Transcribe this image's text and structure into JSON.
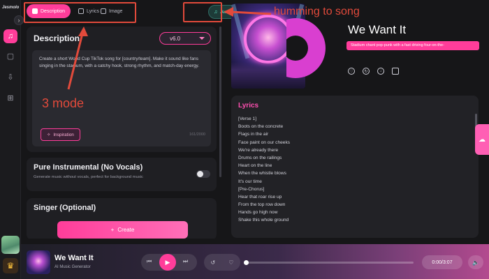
{
  "app": {
    "logo": "Jesmolo"
  },
  "rail": {
    "collapse_icon": "chevron-right-icon",
    "items": [
      {
        "icon": "music-note-icon",
        "active": true
      },
      {
        "icon": "document-icon",
        "active": false
      },
      {
        "icon": "download-icon",
        "active": false
      },
      {
        "icon": "grid-icon",
        "active": false
      }
    ],
    "crown_icon": "crown-icon"
  },
  "tabs": [
    {
      "label": "Description",
      "icon": "description-icon",
      "active": true
    },
    {
      "label": "Lyrics",
      "icon": "lyrics-icon",
      "active": false
    },
    {
      "label": "Image",
      "icon": "image-icon",
      "active": false
    }
  ],
  "audio_button": {
    "label": "Audio",
    "icon": "audio-icon"
  },
  "description": {
    "title": "Description",
    "version": "v6.0",
    "text": "Create a short World Cup TikTok song for [country/team]. Make it sound like fans singing in the stadium, with a catchy hook, strong rhythm, and match-day energy.",
    "inspiration_label": "Inspiration",
    "counter": "161/2000"
  },
  "instrumental": {
    "title": "Pure Instrumental (No Vocals)",
    "subtitle": "Generate music without vocals, perfect for background music",
    "enabled": false
  },
  "singer": {
    "title": "Singer (Optional)"
  },
  "create_button": {
    "label": "Create"
  },
  "song": {
    "title": "We Want It",
    "style_tag": "Stadium chant pop-punk with a fast driving four-on-the-",
    "actions": [
      "heart-icon",
      "remix-icon",
      "download-icon",
      "more-icon"
    ]
  },
  "lyrics": {
    "title": "Lyrics",
    "lines": [
      "[Verse 1]",
      "Boots on the concrete",
      "Flags in the air",
      "Face paint on our cheeks",
      "We're already there",
      "Drums on the railings",
      "Heart on the line",
      "When the whistle blows",
      "It's our time",
      "[Pre-Chorus]",
      "Hear that roar rise up",
      "From the top row down",
      "Hands go high now",
      "Shake this whole ground"
    ]
  },
  "player": {
    "title": "We Want It",
    "subtitle": "AI Music Generator",
    "time": "0:00/3:07",
    "progress": 0
  },
  "annotations": {
    "mode_note": "3 mode",
    "audio_note": "humming to song",
    "color": "#e24a3b"
  },
  "colors": {
    "accent": "#ff3d9a",
    "audio": "#5ff0d0"
  }
}
